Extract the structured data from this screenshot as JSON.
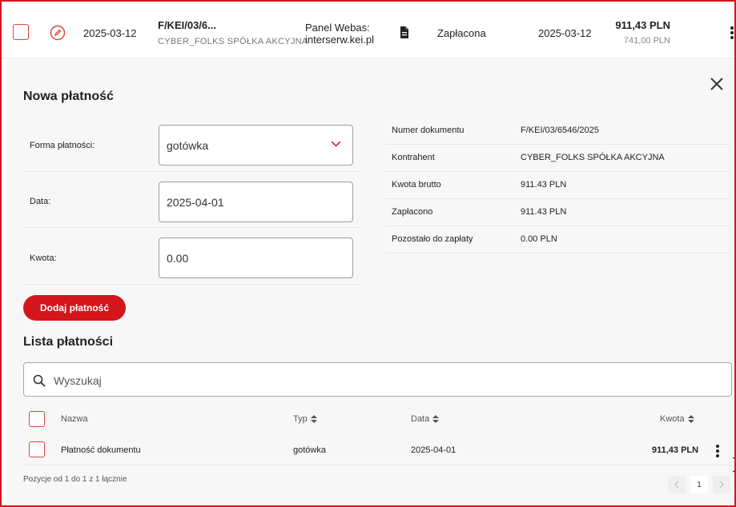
{
  "document_row": {
    "date": "2025-03-12",
    "number": "F/KEI/03/6...",
    "company": "CYBER_FOLKS SPÓŁKA AKCYJNA",
    "panel_line1": "Panel Webas:",
    "panel_line2": "interserw.kei.pl",
    "status": "Zapłacona",
    "due_date": "2025-03-12",
    "amount_gross": "911,43 PLN",
    "amount_net": "741,00 PLN"
  },
  "new_payment": {
    "title": "Nowa płatność",
    "method_label": "Forma płatności:",
    "method_value": "gotówka",
    "date_label": "Data:",
    "date_value": "2025-04-01",
    "amount_label": "Kwota:",
    "amount_value": "0.00",
    "add_button": "Dodaj płatność"
  },
  "doc_info": [
    {
      "key": "Numer dokumentu",
      "value": "F/KEI/03/6546/2025"
    },
    {
      "key": "Kontrahent",
      "value": "CYBER_FOLKS SPÓŁKA AKCYJNA"
    },
    {
      "key": "Kwota brutto",
      "value": "911.43 PLN"
    },
    {
      "key": "Zapłacono",
      "value": "911.43 PLN"
    },
    {
      "key": "Pozostało do zapłaty",
      "value": "0.00 PLN"
    }
  ],
  "payments": {
    "title": "Lista płatności",
    "search_placeholder": "Wyszukaj",
    "columns": {
      "name": "Nazwa",
      "type": "Typ",
      "date": "Data",
      "amount": "Kwota"
    },
    "rows": [
      {
        "name": "Płatność dokumentu",
        "type": "gotówka",
        "date": "2025-04-01",
        "amount": "911,43 PLN"
      }
    ],
    "footer": "Pozycje od 1 do 1 z 1 łącznie",
    "page": "1"
  },
  "icons": [
    "pencil-icon",
    "file-icon",
    "kebab-icon",
    "close-icon",
    "chevron-down-icon",
    "search-icon",
    "sort-icon",
    "chevron-left-icon",
    "chevron-right-icon"
  ],
  "colors": {
    "accent": "#d4151c",
    "panel_bg": "#f7f7f7"
  }
}
